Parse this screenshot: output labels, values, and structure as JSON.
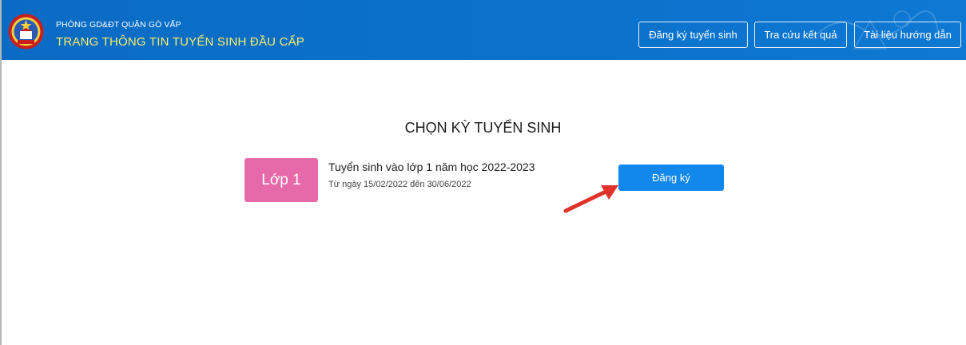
{
  "header": {
    "org_name": "PHÒNG GD&ĐT QUẬN GÒ VẤP",
    "site_title": "TRANG THÔNG TIN TUYỂN SINH ĐẦU CẤP",
    "nav": [
      {
        "label": "Đăng ký tuyển sinh"
      },
      {
        "label": "Tra cứu kết quả"
      },
      {
        "label": "Tài liệu hướng dẫn"
      }
    ],
    "logo_icon": "school-emblem-icon"
  },
  "main": {
    "heading": "CHỌN KỲ TUYỂN SINH",
    "session": {
      "grade_label": "Lớp 1",
      "title": "Tuyển sinh vào lớp 1 năm học 2022-2023",
      "date_range": "Từ ngày 15/02/2022 đến 30/06/2022",
      "register_label": "Đăng ký"
    }
  },
  "colors": {
    "header_bg": "#0a6fc7",
    "site_title": "#f7ee6a",
    "grade_tile": "#e66aa9",
    "register_button": "#1388ec",
    "annotation_arrow": "#e0322a"
  }
}
